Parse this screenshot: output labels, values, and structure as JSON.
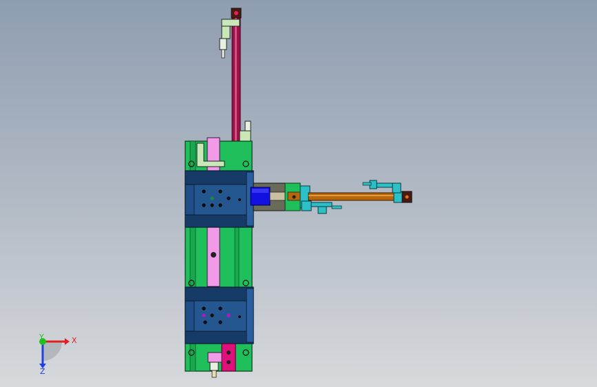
{
  "view": {
    "background_top": "#8e9db0",
    "background_bottom": "#d7d9dc"
  },
  "model": {
    "colors": {
      "base_plate": "#1fbf5c",
      "slide_block": "#1f4f86",
      "slide_block_dark": "#163b66",
      "guide_rail": "#f09ae8",
      "vertical_cylinder_rod": "#a01048",
      "horizontal_cylinder_rod": "#b8660a",
      "motor": "#1010e0",
      "sensor": "#2cc0c8",
      "bracket": "#c8e8b8",
      "end_block": "#e0107a",
      "end_cap": "#4a1a10"
    }
  },
  "triad": {
    "x_label": "X",
    "y_label": "Y",
    "z_label": "Z",
    "x_color": "#e02020",
    "y_color": "#20c020",
    "z_color": "#2040e0",
    "icon": "coordinate-triad-icon"
  }
}
